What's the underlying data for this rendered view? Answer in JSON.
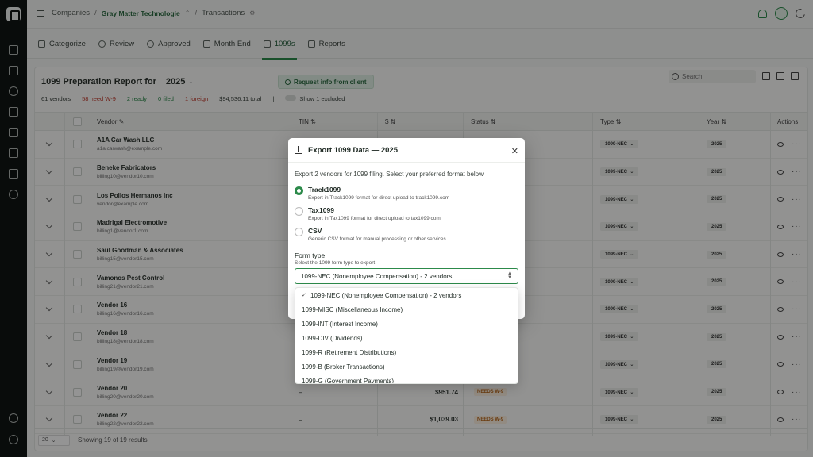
{
  "breadcrumb": {
    "root": "Companies",
    "company": "Gray Matter Technologie",
    "page": "Transactions"
  },
  "tabs": [
    {
      "label": "Categorize"
    },
    {
      "label": "Review"
    },
    {
      "label": "Approved"
    },
    {
      "label": "Month End"
    },
    {
      "label": "1099s"
    },
    {
      "label": "Reports"
    }
  ],
  "report": {
    "title": "1099 Preparation Report for",
    "year": "2025",
    "request_button": "Request info from client",
    "search_placeholder": "Search",
    "stats": {
      "vendors": "61 vendors",
      "need_w9": "58 need W-9",
      "ready": "2 ready",
      "filed": "0 filed",
      "foreign": "1 foreign",
      "total": "$94,536.11 total",
      "excluded": "Show 1 excluded"
    }
  },
  "table": {
    "headers": {
      "vendor": "Vendor",
      "tin": "TIN",
      "amount": "$",
      "status": "Status",
      "type": "Type",
      "year": "Year",
      "actions": "Actions"
    },
    "rows": [
      {
        "name": "A1A Car Wash LLC",
        "email": "a1a.carwash@example.com",
        "tin": "",
        "amount": "",
        "status": "",
        "type": "1099-NEC",
        "year": "2025"
      },
      {
        "name": "Beneke Fabricators",
        "email": "billing10@vendor10.com",
        "tin": "",
        "amount": "",
        "status": "",
        "type": "1099-NEC",
        "year": "2025"
      },
      {
        "name": "Los Pollos Hermanos Inc",
        "email": "vendor@example.com",
        "tin": "",
        "amount": "",
        "status": "",
        "type": "1099-NEC",
        "year": "2025"
      },
      {
        "name": "Madrigal Electromotive",
        "email": "billing1@vendor1.com",
        "tin": "",
        "amount": "",
        "status": "",
        "type": "1099-NEC",
        "year": "2025"
      },
      {
        "name": "Saul Goodman & Associates",
        "email": "billing15@vendor15.com",
        "tin": "",
        "amount": "",
        "status": "",
        "type": "1099-NEC",
        "year": "2025"
      },
      {
        "name": "Vamonos Pest Control",
        "email": "billing21@vendor21.com",
        "tin": "",
        "amount": "",
        "status": "",
        "type": "1099-NEC",
        "year": "2025"
      },
      {
        "name": "Vendor 16",
        "email": "billing16@vendor16.com",
        "tin": "",
        "amount": "",
        "status": "",
        "type": "1099-NEC",
        "year": "2025"
      },
      {
        "name": "Vendor 18",
        "email": "billing18@vendor18.com",
        "tin": "",
        "amount": "",
        "status": "",
        "type": "1099-NEC",
        "year": "2025"
      },
      {
        "name": "Vendor 19",
        "email": "billing19@vendor19.com",
        "tin": "",
        "amount": "",
        "status": "",
        "type": "1099-NEC",
        "year": "2025"
      },
      {
        "name": "Vendor 20",
        "email": "billing20@vendor20.com",
        "tin": "–",
        "amount": "$951.74",
        "status": "NEEDS W-9",
        "type": "1099-NEC",
        "year": "2025"
      },
      {
        "name": "Vendor 22",
        "email": "billing22@vendor22.com",
        "tin": "–",
        "amount": "$1,039.03",
        "status": "NEEDS W-9",
        "type": "1099-NEC",
        "year": "2025"
      }
    ]
  },
  "footer": {
    "page_size": "20",
    "results": "Showing 19 of 19 results"
  },
  "modal": {
    "title": "Export 1099 Data — 2025",
    "description": "Export 2 vendors for 1099 filing. Select your preferred format below.",
    "options": [
      {
        "title": "Track1099",
        "desc": "Export in Track1099 format for direct upload to track1099.com"
      },
      {
        "title": "Tax1099",
        "desc": "Export in Tax1099 format for direct upload to tax1099.com"
      },
      {
        "title": "CSV",
        "desc": "Generic CSV format for manual processing or other services"
      }
    ],
    "form_type_label": "Form type",
    "form_type_sub": "Select the 1099 form type to export",
    "selected": "1099-NEC (Nonemployee Compensation) - 2 vendors",
    "dropdown": [
      "1099-NEC (Nonemployee Compensation) - 2 vendors",
      "1099-MISC (Miscellaneous Income)",
      "1099-INT (Interest Income)",
      "1099-DIV (Dividends)",
      "1099-R (Retirement Distributions)",
      "1099-B (Broker Transactions)",
      "1099-G (Government Payments)"
    ]
  },
  "colors": {
    "accent": "#2c8a4a",
    "warn": "#c0392b",
    "needs_w9": "#b7661a"
  }
}
